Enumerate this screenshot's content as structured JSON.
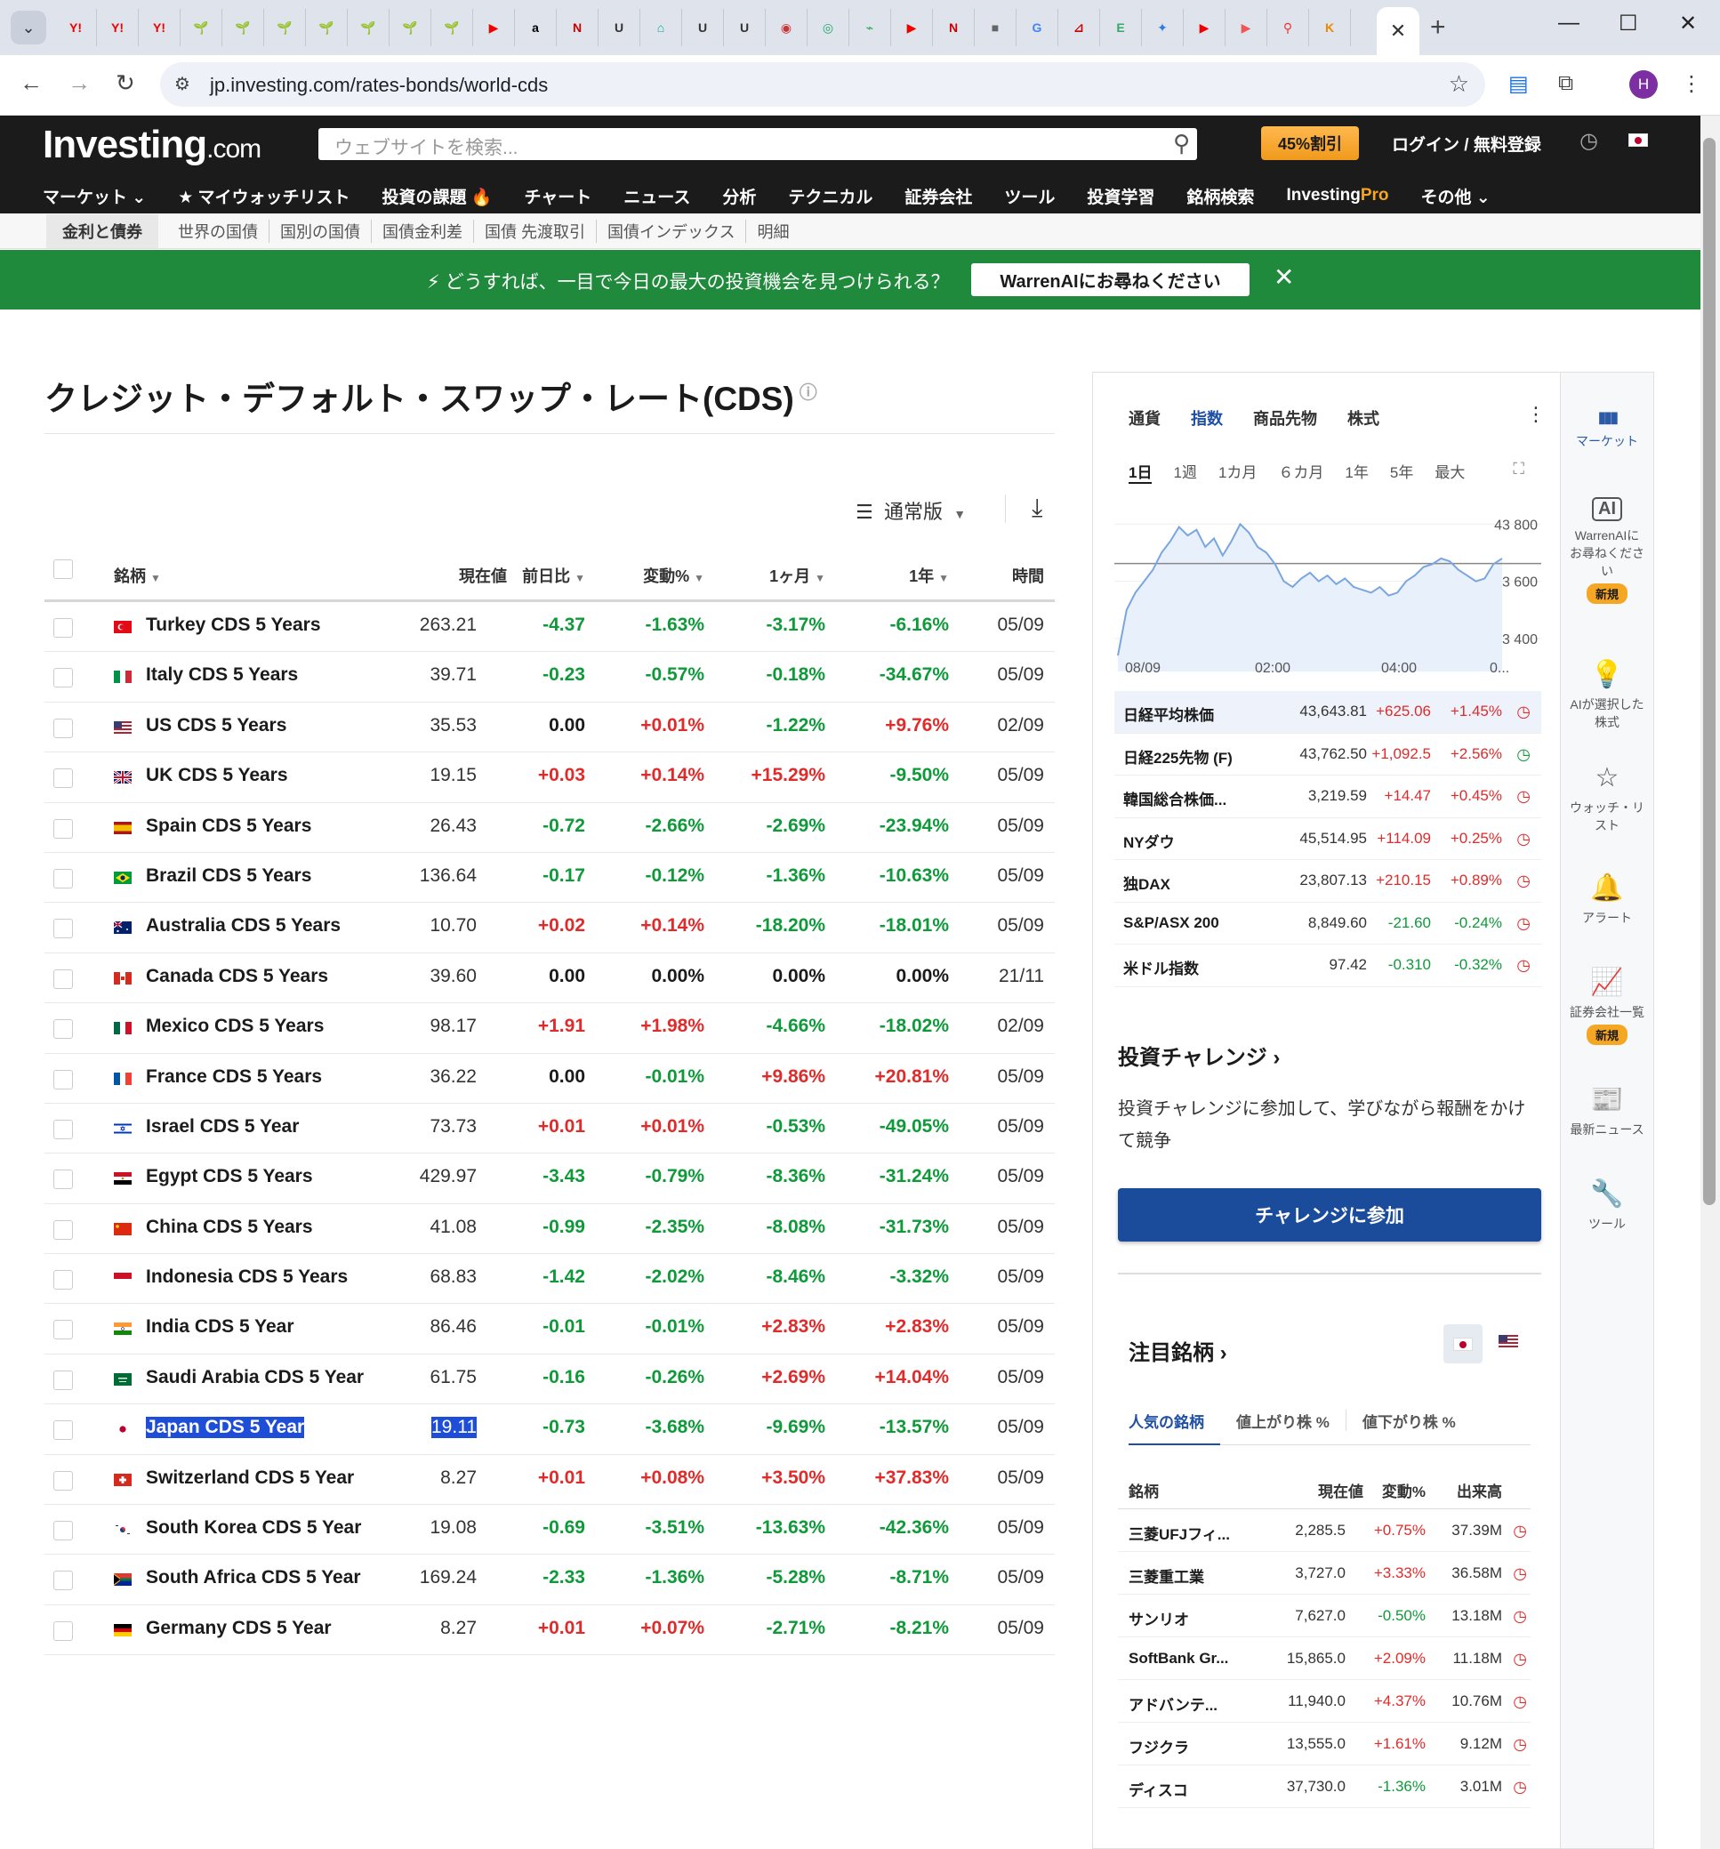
{
  "browser": {
    "url": "jp.investing.com/rates-bonds/world-cds",
    "tab_favicons": [
      "Y!",
      "Y!",
      "Y!",
      "🌱",
      "🌱",
      "🌱",
      "🌱",
      "🌱",
      "🌱",
      "🌱",
      "▶",
      "a",
      "N",
      "U",
      "⌂",
      "U",
      "U",
      "◉",
      "◎",
      "⌁",
      "▶",
      "N",
      "■",
      "G",
      "⊿",
      "E",
      "✦",
      "▶",
      "▶",
      "⚲",
      "K"
    ],
    "avatar_letter": "H"
  },
  "site": {
    "logo_main": "Investing",
    "logo_suffix": ".com",
    "search_placeholder": "ウェブサイトを検索...",
    "promo": "45%割引",
    "login": "ログイン / 無料登録",
    "main_nav": [
      "マーケット ⌄",
      "★ マイウォッチリスト",
      "投資の課題 🔥",
      "チャート",
      "ニュース",
      "分析",
      "テクニカル",
      "証券会社",
      "ツール",
      "投資学習",
      "銘柄検索",
      "Investing",
      "その他 ⌄"
    ],
    "pro_suffix": "Pro",
    "sub_nav": [
      "金利と債券",
      "世界の国債",
      "国別の国債",
      "国債金利差",
      "国債 先渡取引",
      "国債インデックス",
      "明細"
    ],
    "banner_text": "⚡ どうすれば、一目で今日の最大の投資機会を見つけられる？",
    "banner_button": "WarrenAIにお尋ねください",
    "banner_close": "✕"
  },
  "page": {
    "title": "クレジット・デフォルト・スワップ・レート(CDS)",
    "view_label": "通常版",
    "columns": {
      "name": "銘柄",
      "last": "現在値",
      "chg": "前日比",
      "pct": "変動%",
      "m1": "1ヶ月",
      "y1": "1年",
      "time": "時間"
    },
    "rows": [
      {
        "name": "Turkey CDS 5 Years",
        "flag": "tr",
        "last": "263.21",
        "chg": "-4.37",
        "pct": "-1.63%",
        "m1": "-3.17%",
        "y1": "-6.16%",
        "time": "05/09"
      },
      {
        "name": "Italy CDS 5 Years",
        "flag": "it",
        "last": "39.71",
        "chg": "-0.23",
        "pct": "-0.57%",
        "m1": "-0.18%",
        "y1": "-34.67%",
        "time": "05/09"
      },
      {
        "name": "US CDS 5 Years",
        "flag": "us",
        "last": "35.53",
        "chg": "0.00",
        "pct": "+0.01%",
        "m1": "-1.22%",
        "y1": "+9.76%",
        "time": "02/09"
      },
      {
        "name": "UK CDS 5 Years",
        "flag": "uk",
        "last": "19.15",
        "chg": "+0.03",
        "pct": "+0.14%",
        "m1": "+15.29%",
        "y1": "-9.50%",
        "time": "05/09"
      },
      {
        "name": "Spain CDS 5 Years",
        "flag": "es",
        "last": "26.43",
        "chg": "-0.72",
        "pct": "-2.66%",
        "m1": "-2.69%",
        "y1": "-23.94%",
        "time": "05/09"
      },
      {
        "name": "Brazil CDS 5 Years",
        "flag": "br",
        "last": "136.64",
        "chg": "-0.17",
        "pct": "-0.12%",
        "m1": "-1.36%",
        "y1": "-10.63%",
        "time": "05/09"
      },
      {
        "name": "Australia CDS 5 Years",
        "flag": "au",
        "last": "10.70",
        "chg": "+0.02",
        "pct": "+0.14%",
        "m1": "-18.20%",
        "y1": "-18.01%",
        "time": "05/09"
      },
      {
        "name": "Canada CDS 5 Years",
        "flag": "ca",
        "last": "39.60",
        "chg": "0.00",
        "pct": "0.00%",
        "m1": "0.00%",
        "y1": "0.00%",
        "time": "21/11"
      },
      {
        "name": "Mexico CDS 5 Years",
        "flag": "mx",
        "last": "98.17",
        "chg": "+1.91",
        "pct": "+1.98%",
        "m1": "-4.66%",
        "y1": "-18.02%",
        "time": "02/09"
      },
      {
        "name": "France CDS 5 Years",
        "flag": "fr",
        "last": "36.22",
        "chg": "0.00",
        "pct": "-0.01%",
        "m1": "+9.86%",
        "y1": "+20.81%",
        "time": "05/09"
      },
      {
        "name": "Israel CDS 5 Year",
        "flag": "il",
        "last": "73.73",
        "chg": "+0.01",
        "pct": "+0.01%",
        "m1": "-0.53%",
        "y1": "-49.05%",
        "time": "05/09"
      },
      {
        "name": "Egypt CDS 5 Years",
        "flag": "eg",
        "last": "429.97",
        "chg": "-3.43",
        "pct": "-0.79%",
        "m1": "-8.36%",
        "y1": "-31.24%",
        "time": "05/09"
      },
      {
        "name": "China CDS 5 Years",
        "flag": "cn",
        "last": "41.08",
        "chg": "-0.99",
        "pct": "-2.35%",
        "m1": "-8.08%",
        "y1": "-31.73%",
        "time": "05/09"
      },
      {
        "name": "Indonesia CDS 5 Years",
        "flag": "id",
        "last": "68.83",
        "chg": "-1.42",
        "pct": "-2.02%",
        "m1": "-8.46%",
        "y1": "-3.32%",
        "time": "05/09"
      },
      {
        "name": "India CDS 5 Year",
        "flag": "in",
        "last": "86.46",
        "chg": "-0.01",
        "pct": "-0.01%",
        "m1": "+2.83%",
        "y1": "+2.83%",
        "time": "05/09"
      },
      {
        "name": "Saudi Arabia CDS 5 Year",
        "flag": "sa",
        "last": "61.75",
        "chg": "-0.16",
        "pct": "-0.26%",
        "m1": "+2.69%",
        "y1": "+14.04%",
        "time": "05/09"
      },
      {
        "name": "Japan CDS 5 Year",
        "flag": "jp",
        "last": "19.11",
        "chg": "-0.73",
        "pct": "-3.68%",
        "m1": "-9.69%",
        "y1": "-13.57%",
        "time": "05/09",
        "selected": true
      },
      {
        "name": "Switzerland CDS 5 Year",
        "flag": "ch",
        "last": "8.27",
        "chg": "+0.01",
        "pct": "+0.08%",
        "m1": "+3.50%",
        "y1": "+37.83%",
        "time": "05/09"
      },
      {
        "name": "South Korea CDS 5 Year",
        "flag": "kr",
        "last": "19.08",
        "chg": "-0.69",
        "pct": "-3.51%",
        "m1": "-13.63%",
        "y1": "-42.36%",
        "time": "05/09"
      },
      {
        "name": "South Africa CDS 5 Year",
        "flag": "za",
        "last": "169.24",
        "chg": "-2.33",
        "pct": "-1.36%",
        "m1": "-5.28%",
        "y1": "-8.71%",
        "time": "05/09"
      },
      {
        "name": "Germany CDS 5 Year",
        "flag": "de",
        "last": "8.27",
        "chg": "+0.01",
        "pct": "+0.07%",
        "m1": "-2.71%",
        "y1": "-8.21%",
        "time": "05/09"
      }
    ]
  },
  "panel": {
    "tabs": [
      "通貨",
      "指数",
      "商品先物",
      "株式"
    ],
    "active_tab": "指数",
    "ranges": [
      "1日",
      "1週",
      "1カ月",
      "６カ月",
      "1年",
      "5年",
      "最大"
    ],
    "active_range": "1日",
    "chart_data": {
      "type": "line",
      "y_ticks": [
        "43 800",
        "43 600",
        "43 400"
      ],
      "ylim": [
        43300,
        43860
      ],
      "reference_line": 43662,
      "x_ticks": [
        "08/09",
        "02:00",
        "04:00",
        "0..."
      ],
      "values": [
        43340,
        43500,
        43560,
        43600,
        43640,
        43700,
        43740,
        43790,
        43760,
        43780,
        43720,
        43750,
        43690,
        43740,
        43800,
        43770,
        43720,
        43700,
        43660,
        43600,
        43580,
        43610,
        43630,
        43600,
        43620,
        43590,
        43610,
        43580,
        43570,
        43560,
        43580,
        43550,
        43560,
        43600,
        43620,
        43650,
        43660,
        43680,
        43670,
        43640,
        43620,
        43600,
        43610,
        43660,
        43680
      ]
    },
    "indices": [
      {
        "name": "日経平均株価",
        "last": "43,643.81",
        "chg": "+625.06",
        "pct": "+1.45%",
        "dir": "pos",
        "highlight": true
      },
      {
        "name": "日経225先物 (F)",
        "last": "43,762.50",
        "chg": "+1,092.5",
        "pct": "+2.56%",
        "dir": "pos",
        "clock": "green"
      },
      {
        "name": "韓国総合株価...",
        "last": "3,219.59",
        "chg": "+14.47",
        "pct": "+0.45%",
        "dir": "pos"
      },
      {
        "name": "NYダウ",
        "last": "45,514.95",
        "chg": "+114.09",
        "pct": "+0.25%",
        "dir": "pos"
      },
      {
        "name": "独DAX",
        "last": "23,807.13",
        "chg": "+210.15",
        "pct": "+0.89%",
        "dir": "pos"
      },
      {
        "name": "S&P/ASX 200",
        "last": "8,849.60",
        "chg": "-21.60",
        "pct": "-0.24%",
        "dir": "neg"
      },
      {
        "name": "米ドル指数",
        "last": "97.42",
        "chg": "-0.310",
        "pct": "-0.32%",
        "dir": "neg"
      }
    ],
    "challenge": {
      "title": "投資チャレンジ  ›",
      "desc": "投資チャレンジに参加して、学びながら報酬をかけて競争",
      "button": "チャレンジに参加"
    },
    "trending": {
      "title": "注目銘柄  ›",
      "tabs": [
        "人気の銘柄",
        "値上がり株 %",
        "値下がり株 %"
      ],
      "columns": {
        "name": "銘柄",
        "last": "現在値",
        "pct": "変動%",
        "vol": "出来高"
      },
      "rows": [
        {
          "name": "三菱UFJフィ...",
          "last": "2,285.5",
          "pct": "+0.75%",
          "vol": "37.39M",
          "dir": "pos"
        },
        {
          "name": "三菱重工業",
          "last": "3,727.0",
          "pct": "+3.33%",
          "vol": "36.58M",
          "dir": "pos"
        },
        {
          "name": "サンリオ",
          "last": "7,627.0",
          "pct": "-0.50%",
          "vol": "13.18M",
          "dir": "neg"
        },
        {
          "name": "SoftBank Gr...",
          "last": "15,865.0",
          "pct": "+2.09%",
          "vol": "11.18M",
          "dir": "pos"
        },
        {
          "name": "アドバンテ...",
          "last": "11,940.0",
          "pct": "+4.37%",
          "vol": "10.76M",
          "dir": "pos"
        },
        {
          "name": "フジクラ",
          "last": "13,555.0",
          "pct": "+1.61%",
          "vol": "9.12M",
          "dir": "pos"
        },
        {
          "name": "ディスコ",
          "last": "37,730.0",
          "pct": "-1.36%",
          "vol": "3.01M",
          "dir": "neg"
        }
      ]
    }
  },
  "side_nav": [
    {
      "label": "マーケット",
      "icon": "bar-chart-icon",
      "glyph": "▮▮▮"
    },
    {
      "label": "WarrenAIにお尋ねください",
      "icon": "ai-icon",
      "glyph": "AI",
      "badge": "新規"
    },
    {
      "label": "AIが選択した株式",
      "icon": "lightbulb-icon",
      "glyph": "💡"
    },
    {
      "label": "ウォッチ・リスト",
      "icon": "star-icon",
      "glyph": "☆"
    },
    {
      "label": "アラート",
      "icon": "bell-icon",
      "glyph": "🔔"
    },
    {
      "label": "証券会社一覧",
      "icon": "trend-icon",
      "glyph": "📈",
      "badge": "新規"
    },
    {
      "label": "最新ニュース",
      "icon": "news-icon",
      "glyph": "📰"
    },
    {
      "label": "ツール",
      "icon": "wrench-icon",
      "glyph": "🔧"
    }
  ],
  "colors": {
    "positive": "#e02b2b",
    "negative": "#0f9a3a",
    "accent": "#1e4fa3",
    "banner": "#1f8a3b",
    "header": "#1b1b1b"
  }
}
